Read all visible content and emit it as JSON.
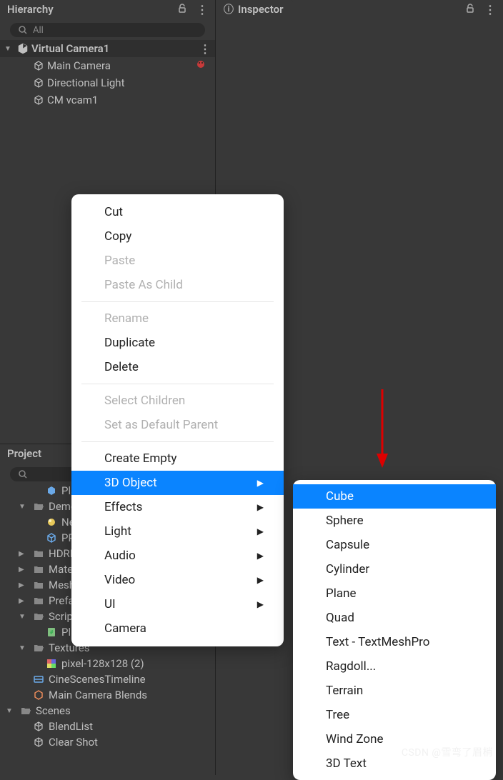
{
  "hierarchy": {
    "tab_label": "Hierarchy",
    "search_placeholder": "All",
    "scene_name": "Virtual Camera1",
    "items": [
      {
        "name": "Main Camera",
        "has_badge": true
      },
      {
        "name": "Directional Light",
        "has_badge": false
      },
      {
        "name": "CM vcam1",
        "has_badge": false
      }
    ]
  },
  "inspector": {
    "tab_label": "Inspector"
  },
  "project": {
    "tab_label": "Project",
    "items": [
      {
        "name": "Pla",
        "indent": 2,
        "icon": "prefab"
      },
      {
        "name": "Demo",
        "indent": 1,
        "icon": "folder-open",
        "toggle": "down"
      },
      {
        "name": "Nev",
        "indent": 2,
        "icon": "sphere"
      },
      {
        "name": "PPV",
        "indent": 2,
        "icon": "cube-blue"
      },
      {
        "name": "HDRP",
        "indent": 1,
        "icon": "folder",
        "toggle": "right"
      },
      {
        "name": "Mater",
        "indent": 1,
        "icon": "folder",
        "toggle": "right"
      },
      {
        "name": "Mesh",
        "indent": 1,
        "icon": "folder",
        "toggle": "right"
      },
      {
        "name": "Prefa",
        "indent": 1,
        "icon": "folder",
        "toggle": "right"
      },
      {
        "name": "Script",
        "indent": 1,
        "icon": "folder-open",
        "toggle": "down"
      },
      {
        "name": "Pla",
        "indent": 2,
        "icon": "script"
      },
      {
        "name": "Textures",
        "indent": 1,
        "icon": "folder-open",
        "toggle": "down"
      },
      {
        "name": "pixel-128x128 (2)",
        "indent": 2,
        "icon": "image"
      },
      {
        "name": "CineScenesTimeline",
        "indent": 1,
        "icon": "timeline"
      },
      {
        "name": "Main Camera Blends",
        "indent": 1,
        "icon": "blend"
      },
      {
        "name": "Scenes",
        "indent": 0,
        "icon": "folder-open",
        "toggle": "down"
      },
      {
        "name": "BlendList",
        "indent": 1,
        "icon": "unity"
      },
      {
        "name": "Clear Shot",
        "indent": 1,
        "icon": "unity"
      }
    ]
  },
  "context_menu": {
    "items": [
      {
        "label": "Cut",
        "type": "item"
      },
      {
        "label": "Copy",
        "type": "item"
      },
      {
        "label": "Paste",
        "type": "item",
        "disabled": true
      },
      {
        "label": "Paste As Child",
        "type": "item",
        "disabled": true
      },
      {
        "type": "sep"
      },
      {
        "label": "Rename",
        "type": "item",
        "disabled": true
      },
      {
        "label": "Duplicate",
        "type": "item"
      },
      {
        "label": "Delete",
        "type": "item"
      },
      {
        "type": "sep"
      },
      {
        "label": "Select Children",
        "type": "item",
        "disabled": true
      },
      {
        "label": "Set as Default Parent",
        "type": "item",
        "disabled": true
      },
      {
        "type": "sep"
      },
      {
        "label": "Create Empty",
        "type": "item"
      },
      {
        "label": "3D Object",
        "type": "item",
        "submenu": true,
        "highlighted": true
      },
      {
        "label": "Effects",
        "type": "item",
        "submenu": true
      },
      {
        "label": "Light",
        "type": "item",
        "submenu": true
      },
      {
        "label": "Audio",
        "type": "item",
        "submenu": true
      },
      {
        "label": "Video",
        "type": "item",
        "submenu": true
      },
      {
        "label": "UI",
        "type": "item",
        "submenu": true
      },
      {
        "label": "Camera",
        "type": "item"
      }
    ]
  },
  "submenu": {
    "items": [
      {
        "label": "Cube",
        "highlighted": true
      },
      {
        "label": "Sphere"
      },
      {
        "label": "Capsule"
      },
      {
        "label": "Cylinder"
      },
      {
        "label": "Plane"
      },
      {
        "label": "Quad"
      },
      {
        "label": "Text - TextMeshPro"
      },
      {
        "label": "Ragdoll..."
      },
      {
        "label": "Terrain"
      },
      {
        "label": "Tree"
      },
      {
        "label": "Wind Zone"
      },
      {
        "label": "3D Text"
      }
    ]
  },
  "watermark": "CSDN @雪弯了眉梢"
}
